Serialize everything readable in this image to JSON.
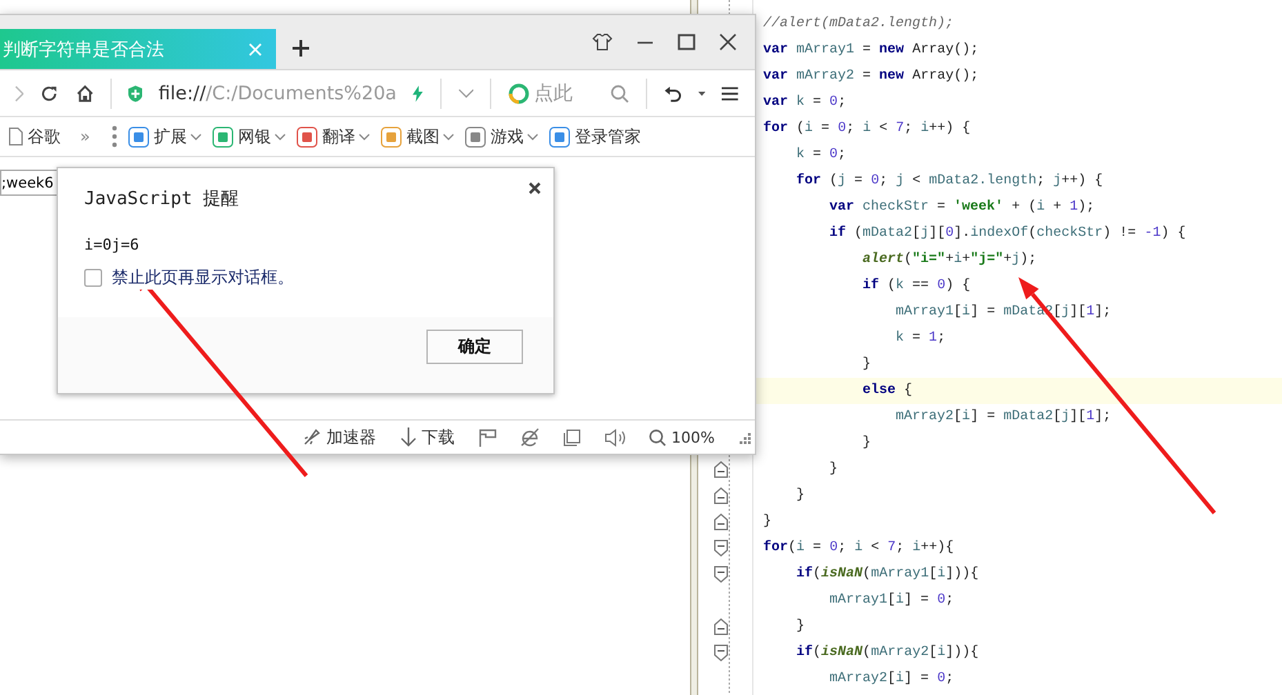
{
  "browser": {
    "tab": {
      "title": "判断字符串是否合法",
      "selected": true
    },
    "address": {
      "scheme": "file://",
      "rest": "/C:/Documents%20a"
    },
    "search": {
      "placeholder": "点此"
    },
    "bookmarks": [
      {
        "label": "谷歌"
      }
    ],
    "overflow": "»",
    "extensions": [
      {
        "label": "扩展"
      },
      {
        "label": "网银"
      },
      {
        "label": "翻译"
      },
      {
        "label": "截图"
      },
      {
        "label": "游戏"
      },
      {
        "label": "登录管家"
      }
    ],
    "page": {
      "input_value": ";week6"
    },
    "status": {
      "accelerator": "加速器",
      "download": "下载",
      "zoom": "100%"
    }
  },
  "dialog": {
    "title": "JavaScript 提醒",
    "message": "i=0j=6",
    "checkbox": {
      "label": "禁止此页再显示对话框。",
      "checked": false
    },
    "button": "确定"
  },
  "editor": {
    "lines": [
      {
        "current": false,
        "tokens": [
          {
            "kind": "comment",
            "text": "//alert(mData2.length);"
          }
        ]
      },
      {
        "current": false,
        "tokens": [
          {
            "kind": "keyword",
            "text": "var"
          },
          {
            "kind": "ident",
            "text": " mArray1"
          },
          {
            "kind": "plain",
            "text": " = "
          },
          {
            "kind": "keyword",
            "text": "new"
          },
          {
            "kind": "plain",
            "text": " Array();"
          }
        ]
      },
      {
        "current": false,
        "tokens": [
          {
            "kind": "keyword",
            "text": "var"
          },
          {
            "kind": "ident",
            "text": " mArray2"
          },
          {
            "kind": "plain",
            "text": " = "
          },
          {
            "kind": "keyword",
            "text": "new"
          },
          {
            "kind": "plain",
            "text": " Array();"
          }
        ]
      },
      {
        "current": false,
        "tokens": [
          {
            "kind": "keyword",
            "text": "var"
          },
          {
            "kind": "ident",
            "text": " k"
          },
          {
            "kind": "plain",
            "text": " = "
          },
          {
            "kind": "number",
            "text": "0"
          },
          {
            "kind": "plain",
            "text": ";"
          }
        ]
      },
      {
        "current": false,
        "tokens": [
          {
            "kind": "keyword",
            "text": "for"
          },
          {
            "kind": "plain",
            "text": " ("
          },
          {
            "kind": "ident",
            "text": "i"
          },
          {
            "kind": "plain",
            "text": " = "
          },
          {
            "kind": "number",
            "text": "0"
          },
          {
            "kind": "plain",
            "text": "; "
          },
          {
            "kind": "ident",
            "text": "i"
          },
          {
            "kind": "plain",
            "text": " < "
          },
          {
            "kind": "number",
            "text": "7"
          },
          {
            "kind": "plain",
            "text": "; "
          },
          {
            "kind": "ident",
            "text": "i"
          },
          {
            "kind": "plain",
            "text": "++) {"
          }
        ]
      },
      {
        "current": false,
        "tokens": [
          {
            "kind": "ident",
            "text": "    k"
          },
          {
            "kind": "plain",
            "text": " = "
          },
          {
            "kind": "number",
            "text": "0"
          },
          {
            "kind": "plain",
            "text": ";"
          }
        ]
      },
      {
        "current": false,
        "tokens": [
          {
            "kind": "keyword",
            "text": "    for"
          },
          {
            "kind": "plain",
            "text": " ("
          },
          {
            "kind": "ident",
            "text": "j"
          },
          {
            "kind": "plain",
            "text": " = "
          },
          {
            "kind": "number",
            "text": "0"
          },
          {
            "kind": "plain",
            "text": "; "
          },
          {
            "kind": "ident",
            "text": "j"
          },
          {
            "kind": "plain",
            "text": " < "
          },
          {
            "kind": "ident",
            "text": "mData2.length"
          },
          {
            "kind": "plain",
            "text": "; "
          },
          {
            "kind": "ident",
            "text": "j"
          },
          {
            "kind": "plain",
            "text": "++) {"
          }
        ]
      },
      {
        "current": false,
        "tokens": [
          {
            "kind": "keyword",
            "text": "        var"
          },
          {
            "kind": "ident",
            "text": " checkStr"
          },
          {
            "kind": "plain",
            "text": " = "
          },
          {
            "kind": "string",
            "text": "'week'"
          },
          {
            "kind": "plain",
            "text": " + ("
          },
          {
            "kind": "ident",
            "text": "i"
          },
          {
            "kind": "plain",
            "text": " + "
          },
          {
            "kind": "number",
            "text": "1"
          },
          {
            "kind": "plain",
            "text": ");"
          }
        ]
      },
      {
        "current": false,
        "tokens": [
          {
            "kind": "keyword",
            "text": "        if"
          },
          {
            "kind": "plain",
            "text": " ("
          },
          {
            "kind": "ident",
            "text": "mData2"
          },
          {
            "kind": "plain",
            "text": "["
          },
          {
            "kind": "ident",
            "text": "j"
          },
          {
            "kind": "plain",
            "text": "]["
          },
          {
            "kind": "number",
            "text": "0"
          },
          {
            "kind": "plain",
            "text": "]."
          },
          {
            "kind": "ident",
            "text": "indexOf"
          },
          {
            "kind": "plain",
            "text": "("
          },
          {
            "kind": "ident",
            "text": "checkStr"
          },
          {
            "kind": "plain",
            "text": ") != "
          },
          {
            "kind": "number",
            "text": "-1"
          },
          {
            "kind": "plain",
            "text": ") {"
          }
        ]
      },
      {
        "current": false,
        "tokens": [
          {
            "kind": "function",
            "text": "            alert"
          },
          {
            "kind": "plain",
            "text": "("
          },
          {
            "kind": "string",
            "text": "\"i=\""
          },
          {
            "kind": "plain",
            "text": "+"
          },
          {
            "kind": "ident",
            "text": "i"
          },
          {
            "kind": "plain",
            "text": "+"
          },
          {
            "kind": "string",
            "text": "\"j=\""
          },
          {
            "kind": "plain",
            "text": "+"
          },
          {
            "kind": "ident",
            "text": "j"
          },
          {
            "kind": "plain",
            "text": ");"
          }
        ]
      },
      {
        "current": false,
        "tokens": [
          {
            "kind": "keyword",
            "text": "            if"
          },
          {
            "kind": "plain",
            "text": " ("
          },
          {
            "kind": "ident",
            "text": "k"
          },
          {
            "kind": "plain",
            "text": " == "
          },
          {
            "kind": "number",
            "text": "0"
          },
          {
            "kind": "plain",
            "text": ") {"
          }
        ]
      },
      {
        "current": false,
        "tokens": [
          {
            "kind": "ident",
            "text": "                mArray1"
          },
          {
            "kind": "plain",
            "text": "["
          },
          {
            "kind": "ident",
            "text": "i"
          },
          {
            "kind": "plain",
            "text": "] = "
          },
          {
            "kind": "ident",
            "text": "mData2"
          },
          {
            "kind": "plain",
            "text": "["
          },
          {
            "kind": "ident",
            "text": "j"
          },
          {
            "kind": "plain",
            "text": "]["
          },
          {
            "kind": "number",
            "text": "1"
          },
          {
            "kind": "plain",
            "text": "];"
          }
        ]
      },
      {
        "current": false,
        "tokens": [
          {
            "kind": "ident",
            "text": "                k"
          },
          {
            "kind": "plain",
            "text": " = "
          },
          {
            "kind": "number",
            "text": "1"
          },
          {
            "kind": "plain",
            "text": ";"
          }
        ]
      },
      {
        "current": false,
        "tokens": [
          {
            "kind": "plain",
            "text": "            }"
          }
        ]
      },
      {
        "current": true,
        "tokens": [
          {
            "kind": "keyword",
            "text": "            else"
          },
          {
            "kind": "plain",
            "text": " {"
          }
        ]
      },
      {
        "current": false,
        "tokens": [
          {
            "kind": "ident",
            "text": "                mArray2"
          },
          {
            "kind": "plain",
            "text": "["
          },
          {
            "kind": "ident",
            "text": "i"
          },
          {
            "kind": "plain",
            "text": "] = "
          },
          {
            "kind": "ident",
            "text": "mData2"
          },
          {
            "kind": "plain",
            "text": "["
          },
          {
            "kind": "ident",
            "text": "j"
          },
          {
            "kind": "plain",
            "text": "]["
          },
          {
            "kind": "number",
            "text": "1"
          },
          {
            "kind": "plain",
            "text": "];"
          }
        ]
      },
      {
        "current": false,
        "tokens": [
          {
            "kind": "plain",
            "text": "            }"
          }
        ]
      },
      {
        "current": false,
        "fold_start": false,
        "fold_end": true,
        "tokens": [
          {
            "kind": "plain",
            "text": "        }"
          }
        ]
      },
      {
        "current": false,
        "fold_start": false,
        "fold_end": true,
        "tokens": [
          {
            "kind": "plain",
            "text": "    }"
          }
        ]
      },
      {
        "current": false,
        "fold_start": false,
        "fold_end": true,
        "tokens": [
          {
            "kind": "plain",
            "text": "}"
          }
        ]
      },
      {
        "current": false,
        "fold_start": true,
        "fold_end": false,
        "tokens": [
          {
            "kind": "keyword",
            "text": "for"
          },
          {
            "kind": "plain",
            "text": "("
          },
          {
            "kind": "ident",
            "text": "i"
          },
          {
            "kind": "plain",
            "text": " = "
          },
          {
            "kind": "number",
            "text": "0"
          },
          {
            "kind": "plain",
            "text": "; "
          },
          {
            "kind": "ident",
            "text": "i"
          },
          {
            "kind": "plain",
            "text": " < "
          },
          {
            "kind": "number",
            "text": "7"
          },
          {
            "kind": "plain",
            "text": "; "
          },
          {
            "kind": "ident",
            "text": "i"
          },
          {
            "kind": "plain",
            "text": "++){"
          }
        ]
      },
      {
        "current": false,
        "fold_start": true,
        "fold_end": false,
        "tokens": [
          {
            "kind": "keyword",
            "text": "    if"
          },
          {
            "kind": "plain",
            "text": "("
          },
          {
            "kind": "function",
            "text": "isNaN"
          },
          {
            "kind": "plain",
            "text": "("
          },
          {
            "kind": "ident",
            "text": "mArray1"
          },
          {
            "kind": "plain",
            "text": "["
          },
          {
            "kind": "ident",
            "text": "i"
          },
          {
            "kind": "plain",
            "text": "])){"
          }
        ]
      },
      {
        "current": false,
        "tokens": [
          {
            "kind": "ident",
            "text": "        mArray1"
          },
          {
            "kind": "plain",
            "text": "["
          },
          {
            "kind": "ident",
            "text": "i"
          },
          {
            "kind": "plain",
            "text": "] = "
          },
          {
            "kind": "number",
            "text": "0"
          },
          {
            "kind": "plain",
            "text": ";"
          }
        ]
      },
      {
        "current": false,
        "fold_start": false,
        "fold_end": true,
        "tokens": [
          {
            "kind": "plain",
            "text": "    }"
          }
        ]
      },
      {
        "current": false,
        "fold_start": true,
        "fold_end": false,
        "tokens": [
          {
            "kind": "keyword",
            "text": "    if"
          },
          {
            "kind": "plain",
            "text": "("
          },
          {
            "kind": "function",
            "text": "isNaN"
          },
          {
            "kind": "plain",
            "text": "("
          },
          {
            "kind": "ident",
            "text": "mArray2"
          },
          {
            "kind": "plain",
            "text": "["
          },
          {
            "kind": "ident",
            "text": "i"
          },
          {
            "kind": "plain",
            "text": "])){"
          }
        ]
      },
      {
        "current": false,
        "tokens": [
          {
            "kind": "ident",
            "text": "        mArray2"
          },
          {
            "kind": "plain",
            "text": "["
          },
          {
            "kind": "ident",
            "text": "i"
          },
          {
            "kind": "plain",
            "text": "] = "
          },
          {
            "kind": "number",
            "text": "0"
          },
          {
            "kind": "plain",
            "text": ";"
          }
        ]
      }
    ]
  }
}
